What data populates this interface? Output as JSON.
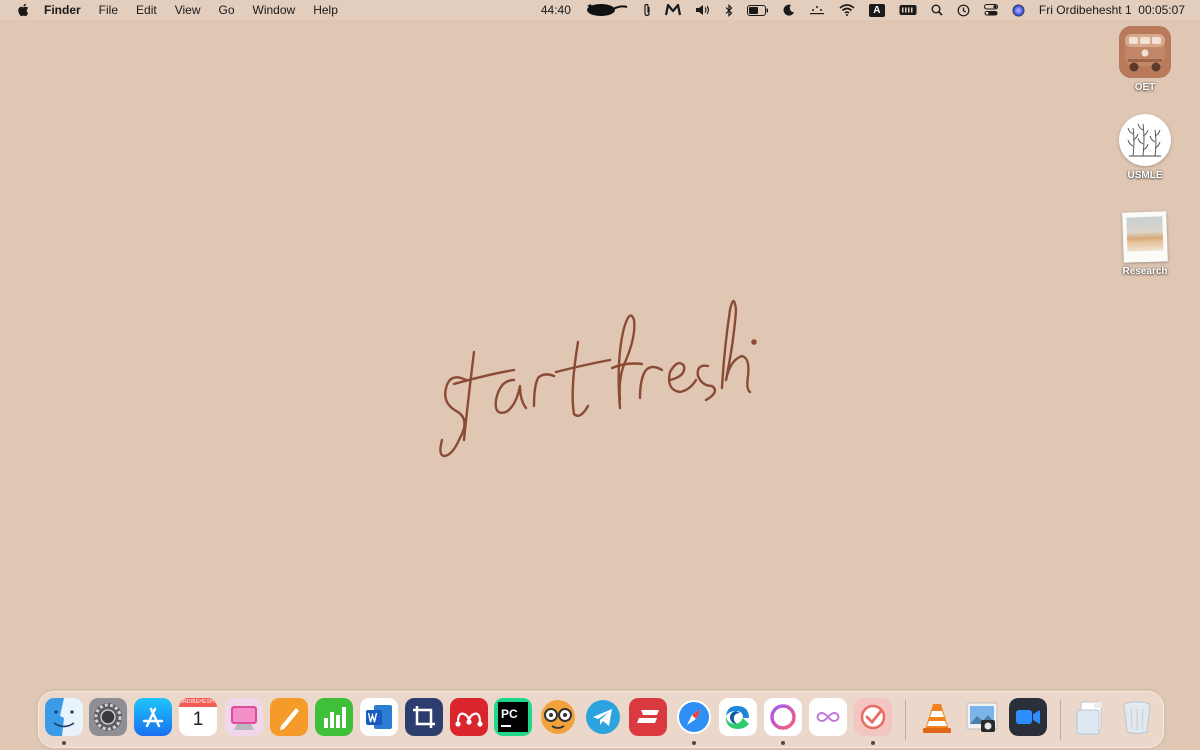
{
  "menubar": {
    "app_name": "Finder",
    "items": [
      "File",
      "Edit",
      "View",
      "Go",
      "Window",
      "Help"
    ],
    "status_time_counter": "44:40",
    "keyboard_input_letter": "A",
    "datetime": "Fri Ordibehesht 1  00:05:07",
    "icons": [
      "apple-icon",
      "redacted-cat-icon",
      "paperclip-icon",
      "m-logo-icon",
      "volume-icon",
      "bluetooth-icon",
      "battery-icon",
      "moon-icon",
      "menu-dots-icon",
      "wifi-icon",
      "input-source-icon",
      "keyboard-icon",
      "search-icon",
      "time-machine-icon",
      "control-center-icon",
      "siri-icon"
    ]
  },
  "wallpaper": {
    "text": "start fresh.",
    "color": "#8a4a34",
    "background": "#dfc7b4"
  },
  "desktop_icons": [
    {
      "label": "OET",
      "icon": "van-folder-icon"
    },
    {
      "label": "USMLE",
      "icon": "plant-circle-icon"
    },
    {
      "label": "Research",
      "icon": "polaroid-photo-icon"
    }
  ],
  "dock": {
    "calendar_month": "ORDIBEHESHT",
    "calendar_day": "1",
    "apps": [
      {
        "name": "Finder",
        "icon": "finder-icon",
        "running": true
      },
      {
        "name": "System Preferences",
        "icon": "gear-icon",
        "running": false
      },
      {
        "name": "App Store",
        "icon": "app-store-icon",
        "running": false
      },
      {
        "name": "Calendar",
        "icon": "calendar-icon",
        "running": false
      },
      {
        "name": "CleanMyMac",
        "icon": "cleanmymac-icon",
        "running": false
      },
      {
        "name": "Pages",
        "icon": "pages-icon",
        "running": false
      },
      {
        "name": "Numbers",
        "icon": "numbers-icon",
        "running": false
      },
      {
        "name": "Microsoft Word",
        "icon": "word-icon",
        "running": false
      },
      {
        "name": "Screenshot",
        "icon": "crop-icon",
        "running": false
      },
      {
        "name": "Mendeley",
        "icon": "mendeley-icon",
        "running": false
      },
      {
        "name": "PyCharm",
        "icon": "pycharm-icon",
        "running": false
      },
      {
        "name": "Gibbon",
        "icon": "glasses-face-icon",
        "running": false
      },
      {
        "name": "Telegram",
        "icon": "telegram-icon",
        "running": false
      },
      {
        "name": "ExpressVPN",
        "icon": "expressvpn-icon",
        "running": false
      },
      {
        "name": "Safari",
        "icon": "compass-icon",
        "running": true
      },
      {
        "name": "Microsoft Edge",
        "icon": "edge-icon",
        "running": false
      },
      {
        "name": "Circle App",
        "icon": "ring-icon",
        "running": true
      },
      {
        "name": "Infinity App",
        "icon": "infinity-icon",
        "running": false
      },
      {
        "name": "Tasks",
        "icon": "checkmark-icon",
        "running": true
      },
      {
        "name": "VLC",
        "icon": "vlc-cone-icon",
        "running": false
      },
      {
        "name": "Preview",
        "icon": "preview-icon",
        "running": false
      },
      {
        "name": "Zoom",
        "icon": "zoom-camera-icon",
        "running": false
      },
      {
        "name": "Downloads",
        "icon": "downloads-folder-icon",
        "running": false
      },
      {
        "name": "Trash",
        "icon": "trash-icon",
        "running": false
      }
    ]
  }
}
